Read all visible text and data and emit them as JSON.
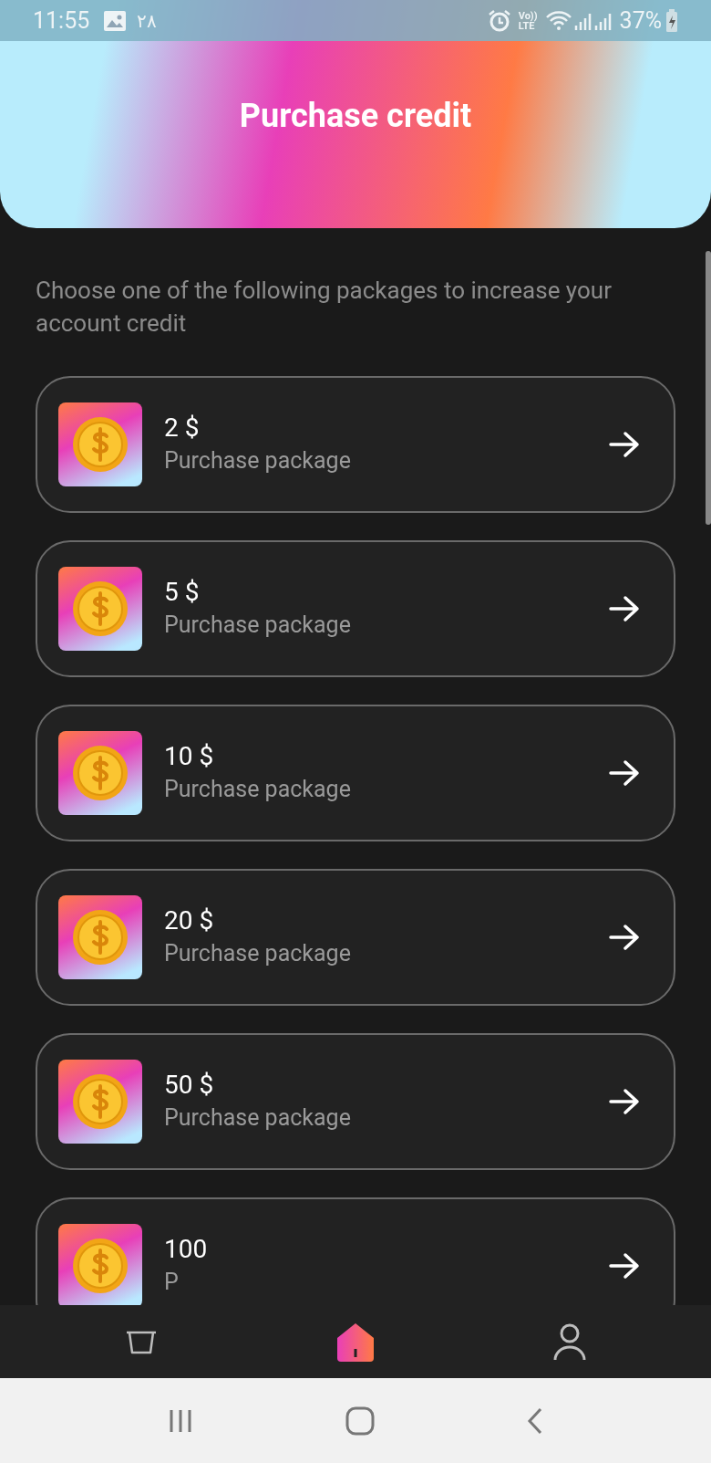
{
  "status_bar": {
    "time": "11:55",
    "date": "٢٨",
    "volte_top": "Vo))",
    "volte_bottom": "LTE",
    "battery": "37%"
  },
  "header": {
    "title": "Purchase credit"
  },
  "description": "Choose one of the following packages to increase your account credit",
  "packages": [
    {
      "amount": "2 $",
      "subtitle": "Purchase package"
    },
    {
      "amount": "5 $",
      "subtitle": "Purchase package"
    },
    {
      "amount": "10 $",
      "subtitle": "Purchase package"
    },
    {
      "amount": "20 $",
      "subtitle": "Purchase package"
    },
    {
      "amount": "50 $",
      "subtitle": "Purchase package"
    },
    {
      "amount": "100",
      "subtitle": "P"
    }
  ],
  "bottom_nav": [
    {
      "kind": "basket",
      "selected": false
    },
    {
      "kind": "home",
      "selected": true
    },
    {
      "kind": "profile",
      "selected": false
    }
  ]
}
